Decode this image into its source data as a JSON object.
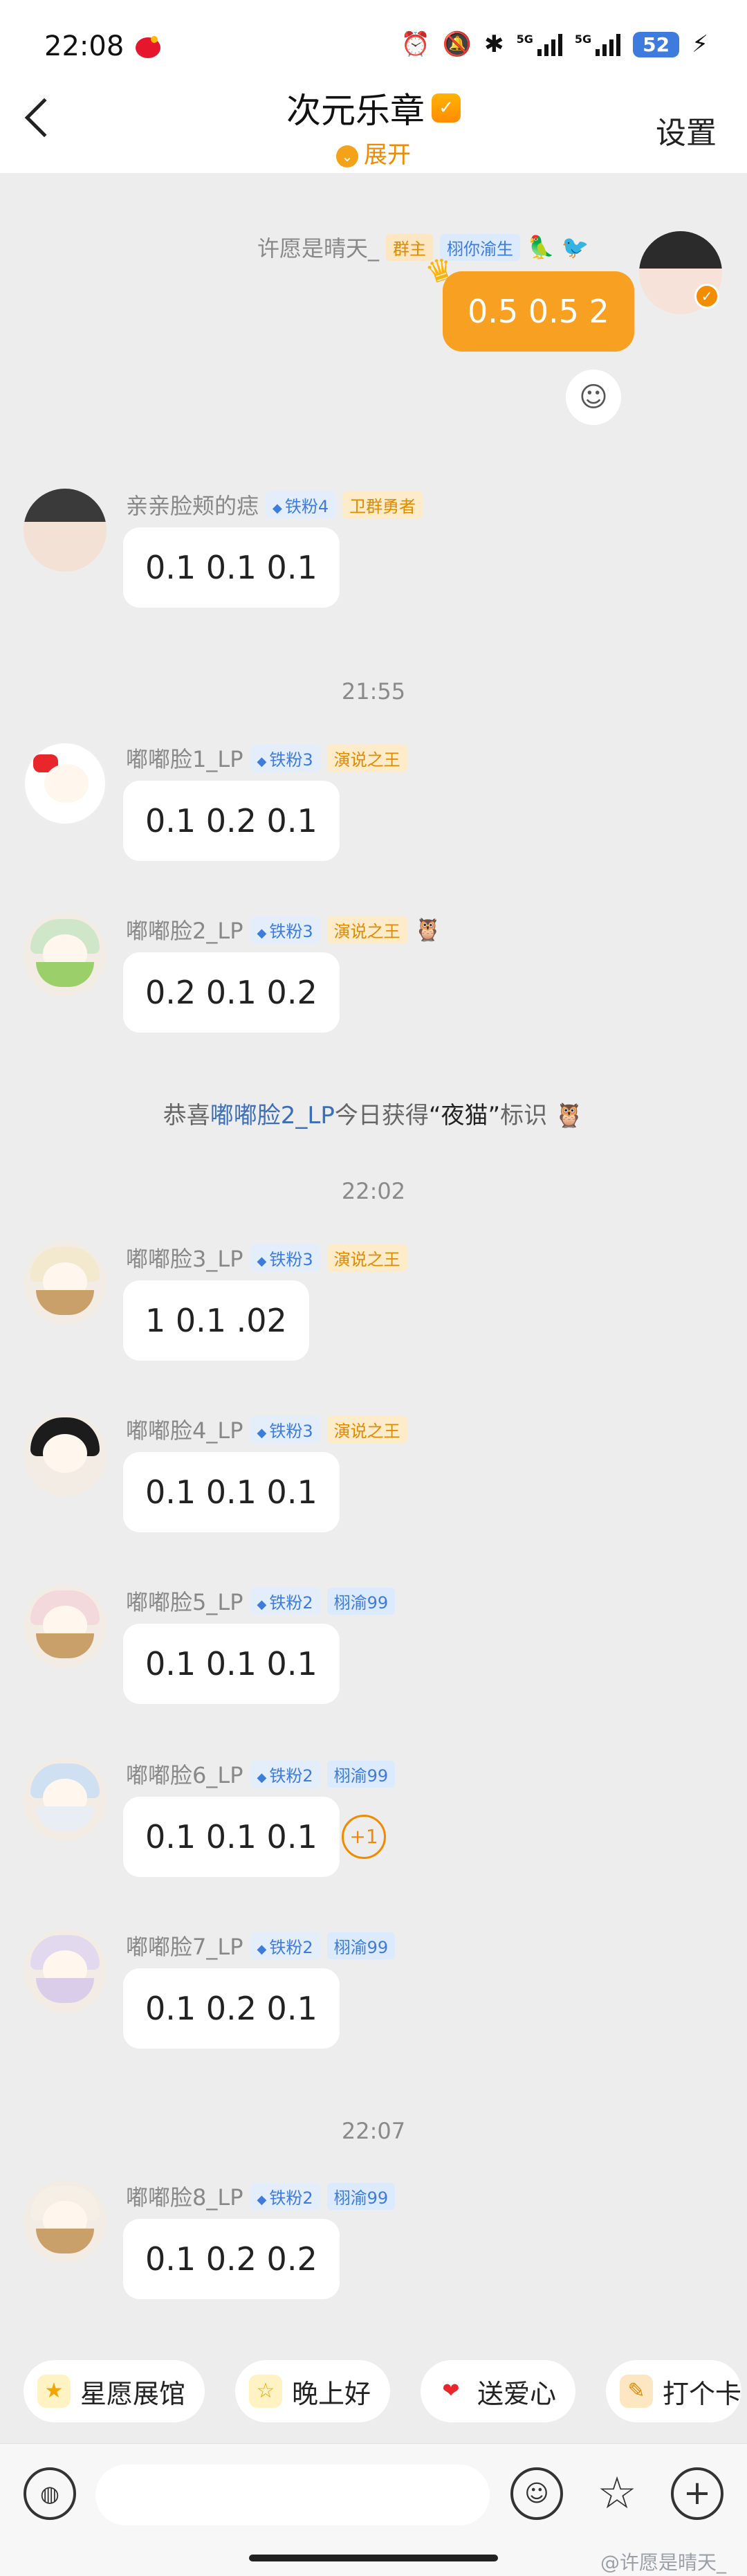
{
  "status": {
    "time": "22:08",
    "battery": "52",
    "net1": "5G",
    "net2": "5G"
  },
  "header": {
    "title": "次元乐章",
    "expand": "展开",
    "settings": "设置"
  },
  "self_msg": {
    "name": "许愿是晴天_",
    "badge_host": "群主",
    "badge_tag": "栩你渝生",
    "text": "0.5 0.5 2"
  },
  "messages": [
    {
      "name": "亲亲脸颊的痣",
      "fan": "铁粉4",
      "tag": "卫群勇者",
      "text": "0.1 0.1 0.1"
    },
    {
      "name": "嘟嘟脸1_LP",
      "fan": "铁粉3",
      "tag": "演说之王",
      "text": "0.1 0.2 0.1"
    },
    {
      "name": "嘟嘟脸2_LP",
      "fan": "铁粉3",
      "tag": "演说之王",
      "text": "0.2 0.1 0.2"
    },
    {
      "name": "嘟嘟脸3_LP",
      "fan": "铁粉3",
      "tag": "演说之王",
      "text": "1 0.1 .02"
    },
    {
      "name": "嘟嘟脸4_LP",
      "fan": "铁粉3",
      "tag": "演说之王",
      "text": "0.1 0.1 0.1"
    },
    {
      "name": "嘟嘟脸5_LP",
      "fan": "铁粉2",
      "tag": "栩渝99",
      "text": "0.1 0.1 0.1"
    },
    {
      "name": "嘟嘟脸6_LP",
      "fan": "铁粉2",
      "tag": "栩渝99",
      "text": "0.1 0.1 0.1"
    },
    {
      "name": "嘟嘟脸7_LP",
      "fan": "铁粉2",
      "tag": "栩渝99",
      "text": "0.1 0.2 0.1"
    },
    {
      "name": "嘟嘟脸8_LP",
      "fan": "铁粉2",
      "tag": "栩渝99",
      "text": "0.1 0.2 0.2"
    }
  ],
  "times": {
    "t1": "21:55",
    "t2": "22:02",
    "t3": "22:07"
  },
  "system": {
    "prefix": "恭喜",
    "user": "嘟嘟脸2_LP",
    "middle": "今日获得",
    "award": "“夜猫”",
    "suffix": "标识"
  },
  "reaction": {
    "plus_one": "+1"
  },
  "quick_replies": [
    "星愿展馆",
    "晚上好",
    "送爱心",
    "打个卡"
  ],
  "input": {
    "placeholder": ""
  },
  "watermark": "@许愿是晴天_"
}
